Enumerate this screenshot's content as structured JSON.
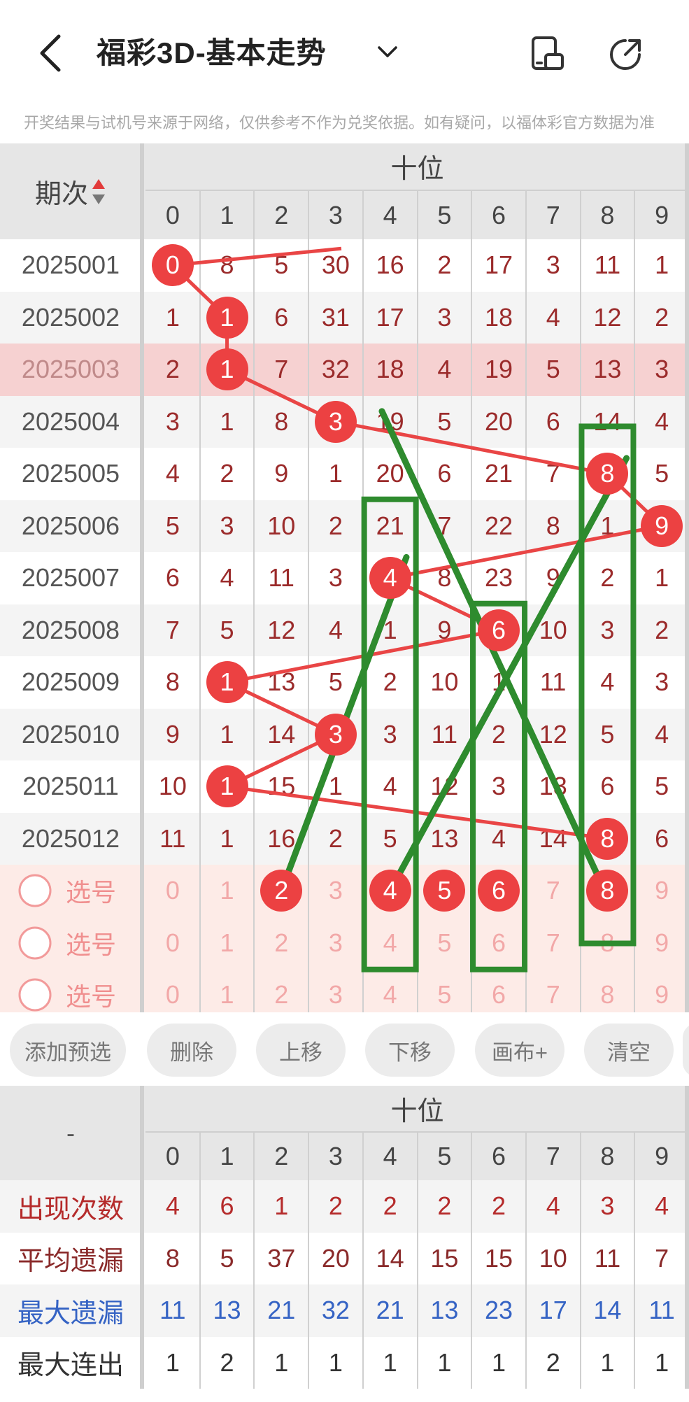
{
  "header": {
    "title": "福彩3D-基本走势",
    "icons": [
      "back-chevron-icon",
      "chevron-down-icon",
      "layout-icon",
      "share-icon"
    ]
  },
  "notice": "开奖结果与试机号来源于网络，仅供参考不作为兑奖依据。如有疑问，以福体彩官方数据为准",
  "table": {
    "issue_header": "期次",
    "group_header": "十位",
    "digits": [
      "0",
      "1",
      "2",
      "3",
      "4",
      "5",
      "6",
      "7",
      "8",
      "9"
    ],
    "rows": [
      {
        "issue": "2025001",
        "values": [
          "0",
          "8",
          "5",
          "30",
          "16",
          "2",
          "17",
          "3",
          "11",
          "1"
        ],
        "hit": 0
      },
      {
        "issue": "2025002",
        "values": [
          "1",
          "1",
          "6",
          "31",
          "17",
          "3",
          "18",
          "4",
          "12",
          "2"
        ],
        "hit": 1
      },
      {
        "issue": "2025003",
        "values": [
          "2",
          "1",
          "7",
          "32",
          "18",
          "4",
          "19",
          "5",
          "13",
          "3"
        ],
        "hit": 1
      },
      {
        "issue": "2025004",
        "values": [
          "3",
          "1",
          "8",
          "3",
          "19",
          "5",
          "20",
          "6",
          "14",
          "4"
        ],
        "hit": 3
      },
      {
        "issue": "2025005",
        "values": [
          "4",
          "2",
          "9",
          "1",
          "20",
          "6",
          "21",
          "7",
          "8",
          "5"
        ],
        "hit": 8
      },
      {
        "issue": "2025006",
        "values": [
          "5",
          "3",
          "10",
          "2",
          "21",
          "7",
          "22",
          "8",
          "1",
          "9"
        ],
        "hit": 9
      },
      {
        "issue": "2025007",
        "values": [
          "6",
          "4",
          "11",
          "3",
          "4",
          "8",
          "23",
          "9",
          "2",
          "1"
        ],
        "hit": 4
      },
      {
        "issue": "2025008",
        "values": [
          "7",
          "5",
          "12",
          "4",
          "1",
          "9",
          "6",
          "10",
          "3",
          "2"
        ],
        "hit": 6
      },
      {
        "issue": "2025009",
        "values": [
          "8",
          "1",
          "13",
          "5",
          "2",
          "10",
          "1",
          "11",
          "4",
          "3"
        ],
        "hit": 1
      },
      {
        "issue": "2025010",
        "values": [
          "9",
          "1",
          "14",
          "3",
          "3",
          "11",
          "2",
          "12",
          "5",
          "4"
        ],
        "hit": 3
      },
      {
        "issue": "2025011",
        "values": [
          "10",
          "1",
          "15",
          "1",
          "4",
          "12",
          "3",
          "13",
          "6",
          "5"
        ],
        "hit": 1
      },
      {
        "issue": "2025012",
        "values": [
          "11",
          "1",
          "16",
          "2",
          "5",
          "13",
          "4",
          "14",
          "8",
          "6"
        ],
        "hit": 8
      }
    ],
    "highlight_issue": "2025003",
    "select_label": "选号",
    "select_rows": [
      {
        "selected": [
          2,
          4,
          5,
          6,
          8
        ]
      },
      {
        "selected": []
      },
      {
        "selected": []
      }
    ]
  },
  "toolbar": {
    "buttons": [
      "添加预选",
      "删除",
      "上移",
      "下移",
      "画布+",
      "清空"
    ]
  },
  "stats": {
    "corner": "-",
    "group_header": "十位",
    "digits": [
      "0",
      "1",
      "2",
      "3",
      "4",
      "5",
      "6",
      "7",
      "8",
      "9"
    ],
    "rows": [
      {
        "label": "出现次数",
        "values": [
          "4",
          "6",
          "1",
          "2",
          "2",
          "2",
          "2",
          "4",
          "3",
          "4"
        ],
        "color": "#b52b2b"
      },
      {
        "label": "平均遗漏",
        "values": [
          "8",
          "5",
          "37",
          "20",
          "14",
          "15",
          "15",
          "10",
          "11",
          "7"
        ],
        "color": "#8a2a2a"
      },
      {
        "label": "最大遗漏",
        "values": [
          "11",
          "13",
          "21",
          "32",
          "21",
          "13",
          "23",
          "17",
          "14",
          "11"
        ],
        "color": "#3563c4"
      },
      {
        "label": "最大连出",
        "values": [
          "1",
          "2",
          "1",
          "1",
          "1",
          "1",
          "1",
          "2",
          "1",
          "1"
        ],
        "color": "#333333"
      }
    ]
  },
  "colors": {
    "hit_ball": "#ec4142",
    "miss_text": "#9b2b2b",
    "highlight_row": "#f6d1d1",
    "select_bg": "#fdebe7",
    "green_annotation": "#2e8b2e",
    "blue_text": "#3563c4"
  }
}
